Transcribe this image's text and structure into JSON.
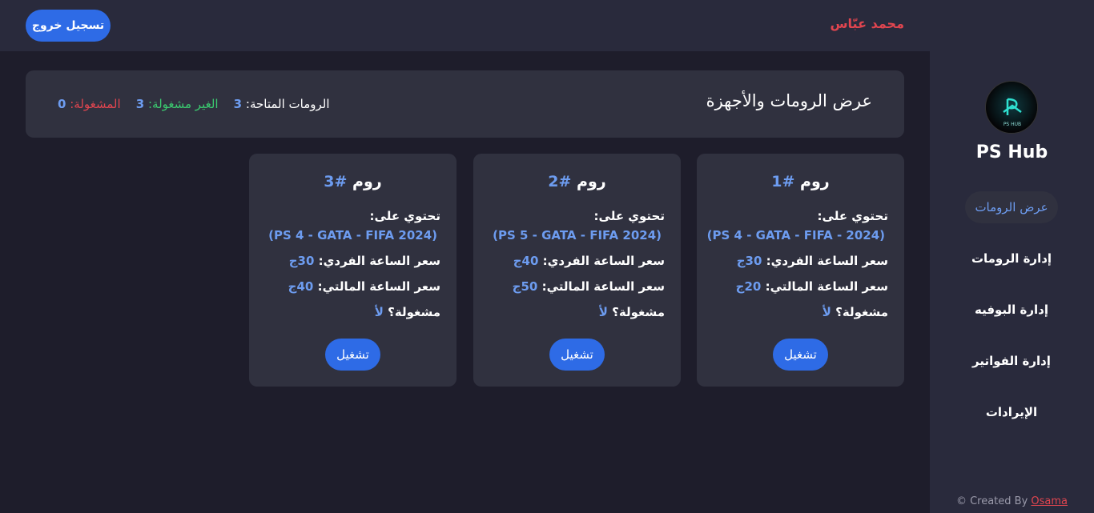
{
  "topbar": {
    "user_name": "محمد عبّاس",
    "logout_label": "تسجيل خروج"
  },
  "sidebar": {
    "brand": "PS Hub",
    "logo_text": "PS HUB",
    "items": [
      {
        "label": "عرض الرومات",
        "active": true
      },
      {
        "label": "إدارة الرومات",
        "active": false
      },
      {
        "label": "إدارة البوفيه",
        "active": false
      },
      {
        "label": "إدارة الفواتير",
        "active": false
      },
      {
        "label": "الإيرادات",
        "active": false
      }
    ],
    "credit_prefix": "© Created By",
    "credit_author": "Osama"
  },
  "header": {
    "title": "عرض الرومات والأجهزة",
    "available_label": "الرومات المتاحة:",
    "available_count": "3",
    "free_label": "الغير مشغولة:",
    "free_count": "3",
    "busy_label": "المشغولة:",
    "busy_count": "0"
  },
  "colors": {
    "accent_blue": "#2e6be6",
    "value_blue": "#6d9cf0",
    "danger_red": "#e0454f",
    "success_green": "#3bc96f"
  },
  "rooms": [
    {
      "title": "روم",
      "number": "#1",
      "contains_label": "تحتوي على:",
      "devices": "(PS 4 - GATA - FIFA - 2024)",
      "single_price_label": "سعر الساعة الفردي:",
      "single_price": "30ج",
      "multi_price_label": "سعر الساعة المالتي:",
      "multi_price": "20ج",
      "busy_label": "مشغولة؟",
      "busy_value": "لأ",
      "run_label": "تشغيل"
    },
    {
      "title": "روم",
      "number": "#2",
      "contains_label": "تحتوي على:",
      "devices": "(PS 5 - GATA - FIFA 2024)",
      "single_price_label": "سعر الساعة الفردي:",
      "single_price": "40ج",
      "multi_price_label": "سعر الساعة المالتي:",
      "multi_price": "50ج",
      "busy_label": "مشغولة؟",
      "busy_value": "لأ",
      "run_label": "تشغيل"
    },
    {
      "title": "روم",
      "number": "#3",
      "contains_label": "تحتوي على:",
      "devices": "(PS 4 - GATA - FIFA 2024)",
      "single_price_label": "سعر الساعة الفردي:",
      "single_price": "30ج",
      "multi_price_label": "سعر الساعة المالتي:",
      "multi_price": "40ج",
      "busy_label": "مشغولة؟",
      "busy_value": "لأ",
      "run_label": "تشغيل"
    }
  ]
}
